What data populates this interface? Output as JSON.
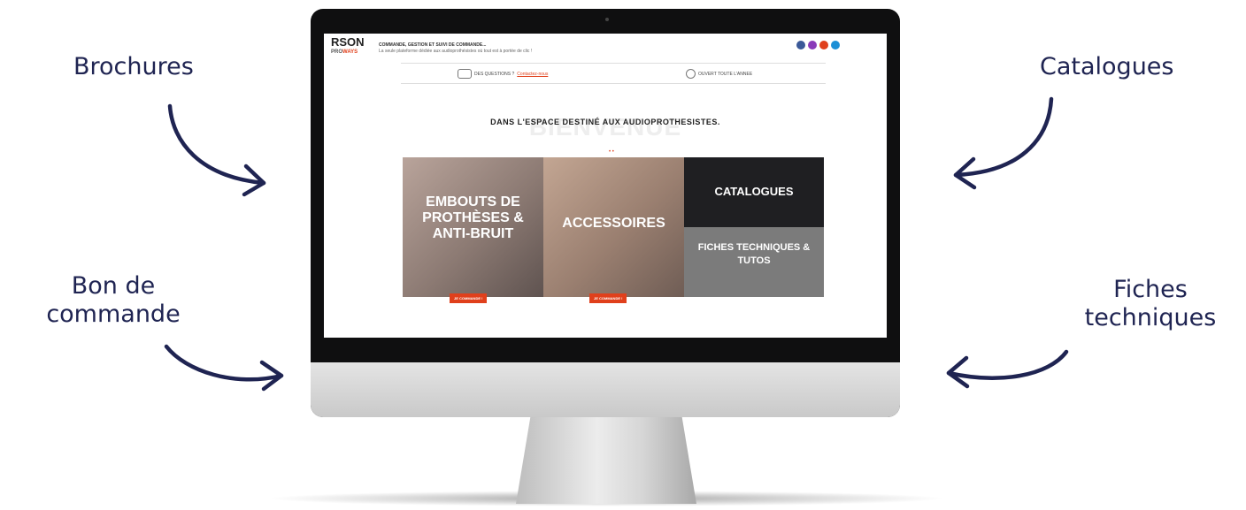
{
  "annotations": {
    "brochures": "Brochures",
    "catalogues": "Catalogues",
    "bon_de_commande_line1": "Bon de",
    "bon_de_commande_line2": "commande",
    "fiches_line1": "Fiches",
    "fiches_line2": "techniques"
  },
  "site": {
    "brand_top": "RSON",
    "brand_bottom_prefix": "PRO",
    "brand_bottom_accent": "WAYS",
    "tagline_title": "COMMANDE, GESTION ET SUIVI DE COMMANDE...",
    "tagline_sub": "La seule plateforme dédiée aux audioprothésistes où tout est à portée de clic !",
    "questions_text": "DES QUESTIONS ?",
    "contact_link": "Contactez-nous",
    "open_text": "OUVERT TOUTE L'ANNEE",
    "bienvenue": "BIENVENUE",
    "headline": "DANS L'ESPACE DESTINÉ AUX AUDIOPROTHESISTES.",
    "tiles": {
      "embouts": "EMBOUTS DE PROTHÈSES & ANTI-BRUIT",
      "accessoires": "ACCESSOIRES",
      "catalogues": "CATALOGUES",
      "fiches": "FICHES TECHNIQUES & TUTOS"
    },
    "order_button": "JE COMMANDE !",
    "social_colors": [
      "#3b5998",
      "#8a3ab9",
      "#e0401c",
      "#1b8fd6"
    ]
  }
}
